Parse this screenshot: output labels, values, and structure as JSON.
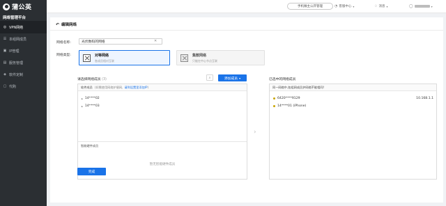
{
  "app": {
    "logo_text": "蒲公英",
    "platform": "网络管理平台"
  },
  "sidebar": {
    "items": [
      {
        "label": "VPN网络",
        "icon": "globe-icon",
        "active": true
      },
      {
        "label": "本组网成员",
        "icon": "users-icon",
        "active": false
      },
      {
        "label": "IP管理",
        "icon": "ip-icon",
        "active": false
      },
      {
        "label": "服务管理",
        "icon": "server-icon",
        "active": false
      },
      {
        "label": "软件定制",
        "icon": "cube-icon",
        "active": false
      },
      {
        "label": "代购",
        "icon": "cart-icon",
        "active": false
      }
    ]
  },
  "topbar": {
    "manage_btn": "手机做主公开管理",
    "service": "客服中心",
    "messages": "消息",
    "user": ""
  },
  "page": {
    "title": "编辑网络"
  },
  "form": {
    "name_label": "网络名称:",
    "name_value": "光伏数码的网络",
    "type_label": "网络类型:",
    "types": [
      {
        "name": "对等网络",
        "desc": "各成员相对互联"
      },
      {
        "name": "集散网络",
        "desc": "只能在中心节点互联"
      }
    ]
  },
  "left_panel": {
    "title": "请选择网络成员",
    "count": "(3)",
    "add_button": "添加成员",
    "header_text": "软件成员",
    "header_hint": "(如需使用网络护盾网,",
    "header_link": "请到设置里添加IP",
    "header_tail": ")",
    "members": [
      "14****02",
      "14****03"
    ],
    "hw_title": "智能硬件成员",
    "empty_text": "暂无智能硬件成员"
  },
  "right_panel": {
    "title": "已选中的网络成员",
    "header_text": "同一网络中,各组网成员护网络不能相同!",
    "members": [
      {
        "name": "6420****9129",
        "ip": "10.168.1.1"
      },
      {
        "name": "14****01 (iPhone)",
        "ip": ""
      }
    ]
  },
  "done_button": "完成"
}
